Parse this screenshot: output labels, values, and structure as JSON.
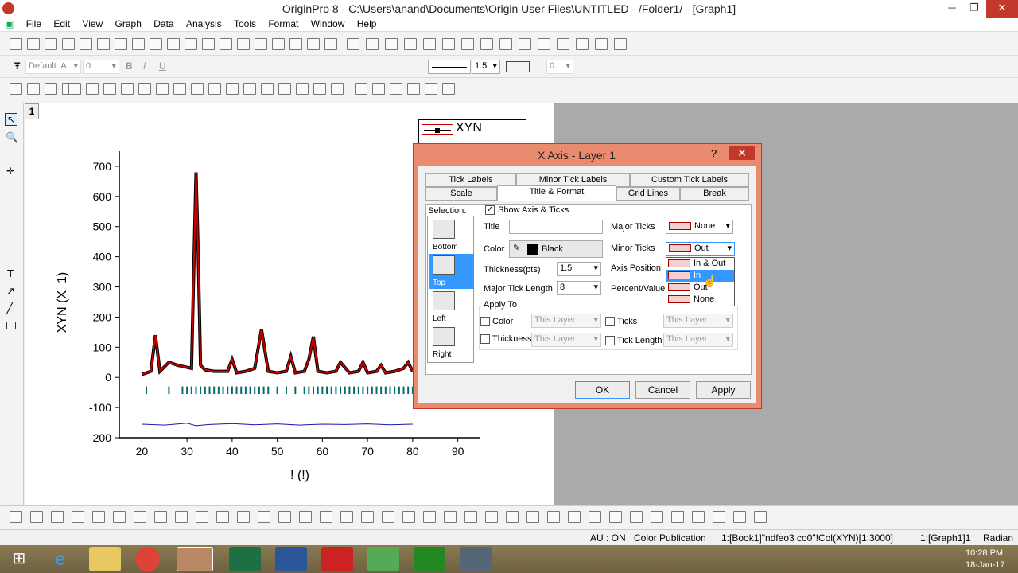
{
  "app": {
    "title": "OriginPro 8 - C:\\Users\\anand\\Documents\\Origin User Files\\UNTITLED - /Folder1/ - [Graph1]",
    "menu": [
      "File",
      "Edit",
      "View",
      "Graph",
      "Data",
      "Analysis",
      "Tools",
      "Format",
      "Window",
      "Help"
    ]
  },
  "format_toolbar": {
    "font": "Default: A",
    "size": "0",
    "line_width": "1.5",
    "value": "0"
  },
  "graph": {
    "window_number": "1",
    "legend": "XYN",
    "ylabel": "XYN (X_1)",
    "xlabel": "! (!)",
    "xticks": [
      "20",
      "30",
      "40",
      "50",
      "60",
      "70",
      "80",
      "90"
    ],
    "yticks": [
      "700",
      "600",
      "500",
      "400",
      "300",
      "200",
      "100",
      "0",
      "-100",
      "-200"
    ]
  },
  "chart_data": {
    "type": "line",
    "xlim": [
      15,
      95
    ],
    "ylim": [
      -200,
      750
    ],
    "series": [
      {
        "name": "XYN",
        "color": "#000000",
        "x": [
          20,
          22,
          23,
          24,
          26,
          28,
          31,
          32,
          32.5,
          33,
          34,
          36,
          39,
          40,
          41,
          43,
          45,
          46.5,
          48,
          50,
          52,
          53,
          54,
          56,
          57,
          58,
          59,
          61,
          63,
          64,
          66,
          68,
          69,
          70,
          72,
          73,
          74,
          76,
          78,
          79,
          80
        ],
        "y": [
          10,
          20,
          140,
          20,
          50,
          40,
          30,
          680,
          400,
          40,
          25,
          20,
          20,
          60,
          15,
          20,
          30,
          160,
          20,
          15,
          20,
          70,
          15,
          20,
          60,
          135,
          20,
          15,
          20,
          50,
          15,
          20,
          50,
          15,
          20,
          40,
          15,
          20,
          30,
          50,
          20
        ]
      },
      {
        "name": "fit",
        "color": "#cc0000",
        "x": [
          20,
          22,
          23,
          24,
          26,
          28,
          31,
          32,
          32.5,
          33,
          34,
          36,
          39,
          40,
          41,
          43,
          45,
          46.5,
          48,
          50,
          52,
          53,
          54,
          56,
          57,
          58,
          59,
          61,
          63,
          64,
          66,
          68,
          69,
          70,
          72,
          73,
          74,
          76,
          78,
          79,
          80
        ],
        "y": [
          10,
          20,
          140,
          20,
          50,
          40,
          30,
          680,
          400,
          40,
          25,
          20,
          20,
          60,
          15,
          20,
          30,
          160,
          20,
          15,
          20,
          70,
          15,
          20,
          60,
          135,
          20,
          15,
          20,
          50,
          15,
          20,
          50,
          15,
          20,
          40,
          15,
          20,
          30,
          50,
          20
        ]
      },
      {
        "name": "difference",
        "color": "#1a1aaa",
        "x": [
          20,
          25,
          30,
          32,
          35,
          40,
          45,
          50,
          55,
          60,
          65,
          70,
          75,
          80
        ],
        "y": [
          -155,
          -158,
          -152,
          -160,
          -156,
          -153,
          -157,
          -154,
          -158,
          -155,
          -156,
          -154,
          -157,
          -155
        ]
      }
    ],
    "ticks_x": [
      21,
      26,
      29,
      30,
      31,
      32,
      33,
      34,
      35,
      36,
      37,
      38,
      39,
      40,
      41,
      42,
      43,
      44,
      45,
      46,
      47,
      48,
      50,
      52,
      54,
      56,
      57,
      58,
      59,
      60,
      61,
      62,
      63,
      64,
      65,
      66,
      67,
      68,
      69,
      70,
      71,
      72,
      73,
      74,
      75,
      76,
      77,
      78,
      79,
      80
    ]
  },
  "dialog": {
    "title": "X Axis - Layer 1",
    "help": "?",
    "close": "✕",
    "tabs_row1": [
      "Tick Labels",
      "Minor Tick Labels",
      "Custom Tick Labels"
    ],
    "tabs_row2": [
      "Scale",
      "Title & Format",
      "Grid Lines",
      "Break"
    ],
    "selection_label": "Selection:",
    "selection": [
      "Bottom",
      "Top",
      "Left",
      "Right"
    ],
    "show_axis_label": "Show Axis & Ticks",
    "title_label": "Title",
    "title_value": "",
    "color_label": "Color",
    "color_value": "Black",
    "thickness_label": "Thickness(pts)",
    "thickness_value": "1.5",
    "major_tick_length_label": "Major Tick Length",
    "major_tick_length_value": "8",
    "major_ticks_label": "Major Ticks",
    "major_ticks_value": "None",
    "minor_ticks_label": "Minor Ticks",
    "minor_ticks_value": "Out",
    "axis_position_label": "Axis Position",
    "percent_value_label": "Percent/Value",
    "apply_to_label": "Apply To",
    "apply_color": "Color",
    "apply_thickness": "Thickness",
    "apply_ticks": "Ticks",
    "apply_tick_length": "Tick Length",
    "this_layer": "This Layer",
    "dropdown_options": [
      "In & Out",
      "In",
      "Out",
      "None"
    ],
    "dropdown_highlighted": "In",
    "ok": "OK",
    "cancel": "Cancel",
    "apply": "Apply"
  },
  "status": {
    "au": "AU : ON",
    "mode": "Color Publication",
    "data": "1:[Book1]\"ndfeo3 co0\"!Col(XYN)[1:3000]",
    "graph": "1:[Graph1]1",
    "angle": "Radian"
  },
  "taskbar": {
    "time": "10:28 PM",
    "date": "18-Jan-17"
  }
}
